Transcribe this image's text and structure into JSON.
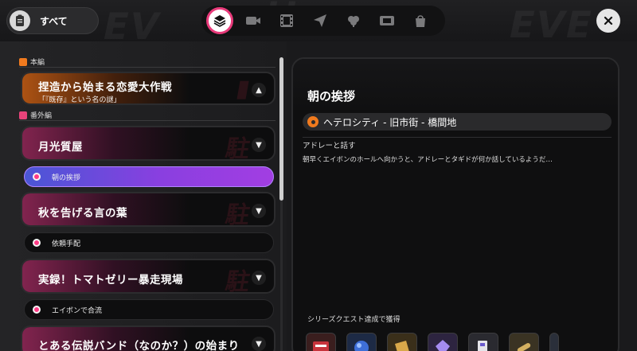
{
  "header": {
    "filter_label": "すべて",
    "category_tabs": [
      {
        "icon": "layers-icon",
        "active": true
      },
      {
        "icon": "video-camera-icon",
        "active": false
      },
      {
        "icon": "film-icon",
        "active": false
      },
      {
        "icon": "paper-plane-icon",
        "active": false
      },
      {
        "icon": "flower-icon",
        "active": false
      },
      {
        "icon": "ticket-icon",
        "active": false
      },
      {
        "icon": "bag-icon",
        "active": false
      }
    ],
    "close_icon": "close-icon"
  },
  "quest_list": {
    "sections": [
      {
        "label": "本編",
        "tag_color": "#f07a1e"
      },
      {
        "label": "番外編",
        "tag_color": "#e8437a"
      }
    ],
    "cards": [
      {
        "title": "捏造から始まる恋愛大作戦",
        "subtitle": "「『既存』という名の謎」",
        "style": "orange",
        "expanded": true
      },
      {
        "title": "月光質屋",
        "expanded": false
      },
      {
        "title": "秋を告げる言の葉",
        "expanded": false
      },
      {
        "title": "実録！トマトゼリー暴走現場",
        "expanded": false
      },
      {
        "title": "とある伝説バンド（なのか？）の始まり",
        "expanded": false
      }
    ],
    "sub_items": [
      {
        "label": "朝の挨拶",
        "active": true
      },
      {
        "label": "依頼手配",
        "active": false
      },
      {
        "label": "エイボンで合流",
        "active": false
      }
    ]
  },
  "detail": {
    "title": "朝の挨拶",
    "location": "ヘテロシティ - 旧市街 - 橋間地",
    "objective": "アドレーと話す",
    "description": "朝早くエイボンのホールへ向かうと、アドレーとタギドが何か話しているようだ…",
    "reward_label": "シリーズクエスト達成で獲得",
    "reward_count": 7
  },
  "colors": {
    "accent_pink": "#e83a7a",
    "active_gradient_start": "#4a56d6",
    "active_gradient_end": "#a23ee2",
    "location_pin": "#f07a1e"
  }
}
